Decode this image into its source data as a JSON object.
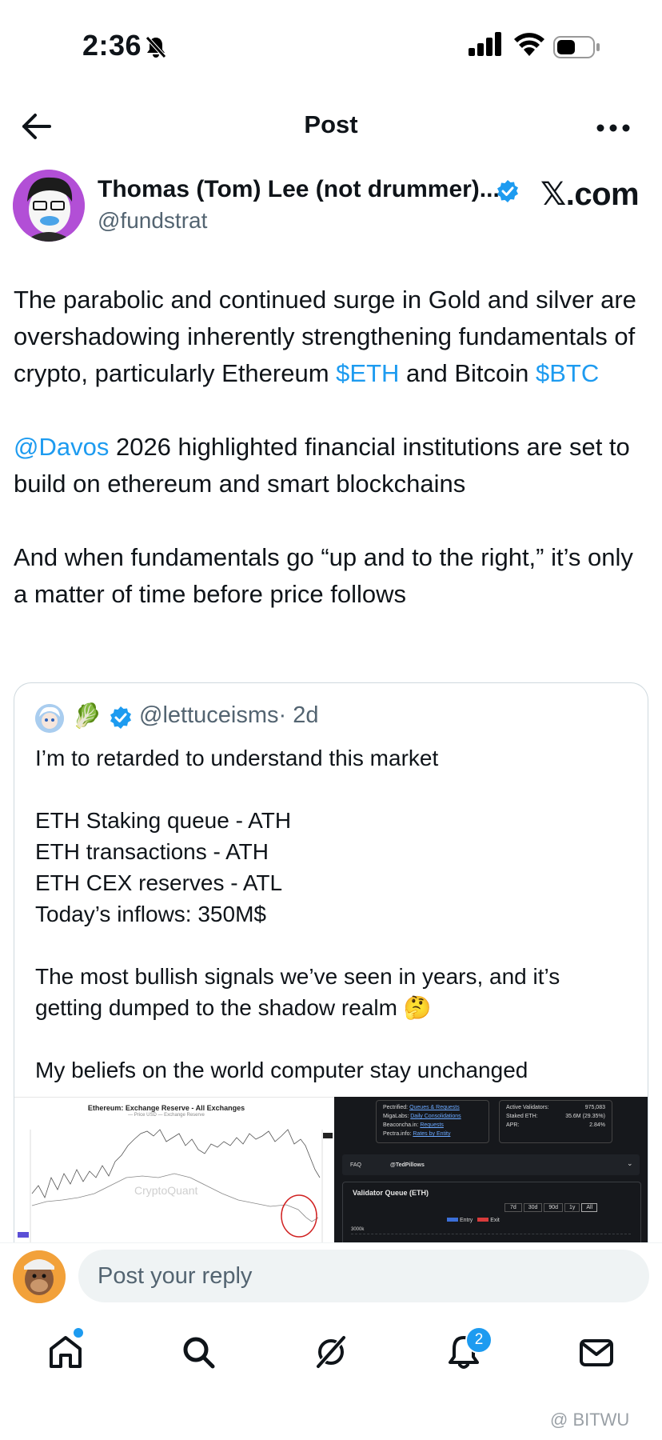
{
  "status_bar": {
    "time": "2:36"
  },
  "header": {
    "title": "Post"
  },
  "author": {
    "name": "Thomas (Tom) Lee (not drummer)...",
    "handle": "@fundstrat",
    "site_label": "com"
  },
  "post": {
    "p1_a": "The parabolic and continued surge in Gold and silver are overshadowing inherently strengthening fundamentals of crypto, particularly Ethereum ",
    "p1_eth": "$ETH",
    "p1_b": " and Bitcoin ",
    "p1_btc": "$BTC",
    "p2_mention": "@Davos",
    "p2_text": " 2026 highlighted financial institutions are set to build on ethereum and smart blockchains",
    "p3": "And when fundamentals go “up and to the right,” it’s only a matter of time before price follows"
  },
  "quote": {
    "emoji": "🥬",
    "handle": "@lettuceisms",
    "age": "· 2d",
    "line1": "I’m to retarded to understand this market",
    "line2": "ETH Staking queue - ATH",
    "line3": "ETH transactions - ATH",
    "line4": "ETH CEX reserves - ATL",
    "line5": "Today’s inflows: 350M$",
    "line6": "The most bullish signals we’ve seen in years, and it’s getting dumped to the shadow realm 🤔",
    "line7": "My beliefs on the world computer stay unchanged",
    "chart_title": "Ethereum: Exchange Reserve - All Exchanges",
    "chart_legend": "— Price USD   — Exchange Reserve",
    "chart_watermark": "CryptoQuant",
    "panel": {
      "pectrified": "Pectrified:",
      "pectrified_link": "Queues & Requests",
      "migalabs": "MigaLabs:",
      "migalabs_link": "Daily Consolidations",
      "beaconcha": "Beaconcha.in:",
      "beaconcha_link": "Requests",
      "pectra": "Pectra.info:",
      "pectra_link": "Rates by Entity",
      "active_label": "Active Validators:",
      "active_value": "975,083",
      "staked_label": "Staked ETH:",
      "staked_value": "35.6M (29.35%)",
      "apr_label": "APR:",
      "apr_value": "2.84%",
      "faq": "FAQ",
      "credit": "@TedPillows",
      "vq_title": "Validator Queue (ETH)",
      "ranges": [
        "7d",
        "30d",
        "90d",
        "1y",
        "All"
      ],
      "entry": "Entry",
      "exit": "Exit",
      "y_tick": "3000k"
    }
  },
  "reply": {
    "placeholder": "Post your reply"
  },
  "tabs": {
    "notifications_badge": "2"
  },
  "watermark": "@ BITWU"
}
